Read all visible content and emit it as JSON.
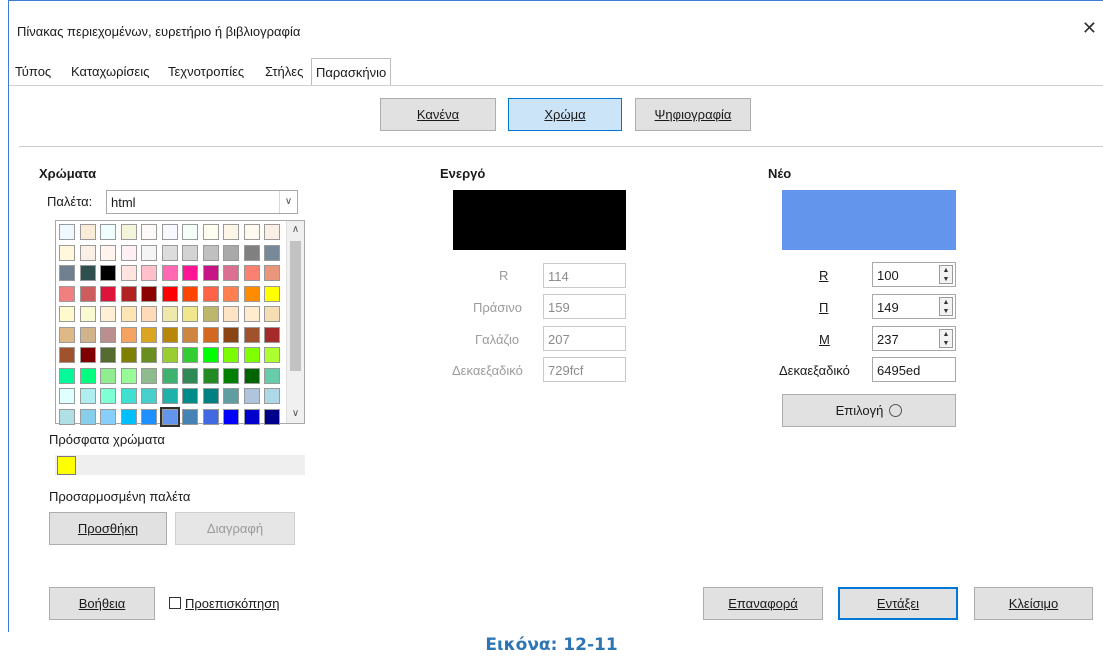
{
  "window": {
    "title": "Πίνακας περιεχομένων, ευρετήριο ή βιβλιογραφία",
    "close_glyph": "✕"
  },
  "tabs": [
    {
      "label": "Τύπος"
    },
    {
      "label": "Καταχωρίσεις"
    },
    {
      "label": "Τεχνοτροπίες"
    },
    {
      "label": "Στήλες"
    },
    {
      "label": "Παρασκήνιο",
      "active": true
    }
  ],
  "background_modes": {
    "none": "Κανένα",
    "color": "Χρώμα",
    "bitmap": "Ψηφιογραφία",
    "selected": "Χρώμα"
  },
  "colors_section": {
    "heading": "Χρώματα",
    "palette_label": "Παλέτα:",
    "palette_value": "html",
    "recent_label": "Πρόσφατα χρώματα",
    "recent_colors": [
      "#ffff00"
    ],
    "custom_palette_label": "Προσαρμοσμένη παλέτα",
    "add_button": "Προσθήκη",
    "delete_button": "Διαγραφή",
    "swatches": [
      [
        "#f0f8ff",
        "#faebd7",
        "#f0ffff",
        "#f5f5dc",
        "#fffafa",
        "#f8f8ff",
        "#f5fffa",
        "#fffff0",
        "#fdf5e6",
        "#fffaf0",
        "#faf0e6"
      ],
      [
        "#fff8dc",
        "#faf0e6",
        "#fff5ee",
        "#fff0f5",
        "#f5f5f5",
        "#dcdcdc",
        "#d3d3d3",
        "#c0c0c0",
        "#a9a9a9",
        "#808080",
        "#778899"
      ],
      [
        "#708090",
        "#2f4f4f",
        "#000000",
        "#ffe4e1",
        "#ffc0cb",
        "#ff69b4",
        "#ff1493",
        "#c71585",
        "#db7093",
        "#fa8072",
        "#e9967a"
      ],
      [
        "#f08080",
        "#cd5c5c",
        "#dc143c",
        "#b22222",
        "#8b0000",
        "#ff0000",
        "#ff4500",
        "#ff6347",
        "#ff7f50",
        "#ff8c00",
        "#ffff00"
      ],
      [
        "#fffacd",
        "#fafad2",
        "#ffefd5",
        "#ffe4b5",
        "#ffdab9",
        "#eee8aa",
        "#f0e68c",
        "#bdb76b",
        "#ffe4c4",
        "#ffebcd",
        "#f5deb3"
      ],
      [
        "#deb887",
        "#d2b48c",
        "#bc8f8f",
        "#f4a460",
        "#daa520",
        "#b8860b",
        "#cd853f",
        "#d2691e",
        "#8b4513",
        "#a0522d",
        "#a52a2a"
      ],
      [
        "#a0522d",
        "#800000",
        "#556b2f",
        "#808000",
        "#6b8e23",
        "#9acd32",
        "#32cd32",
        "#00ff00",
        "#7cfc00",
        "#7fff00",
        "#adff2f"
      ],
      [
        "#00fa9a",
        "#00ff7f",
        "#90ee90",
        "#98fb98",
        "#8fbc8f",
        "#3cb371",
        "#2e8b57",
        "#228b22",
        "#008000",
        "#006400",
        "#66cdaa"
      ],
      [
        "#e0ffff",
        "#afeeee",
        "#7fffd4",
        "#40e0d0",
        "#48d1cc",
        "#20b2aa",
        "#008b8b",
        "#008080",
        "#5f9ea0",
        "#b0c4de",
        "#add8e6"
      ],
      [
        "#b0e0e6",
        "#87ceeb",
        "#87cefa",
        "#00bfff",
        "#1e90ff",
        "#6495ed",
        "#4682b4",
        "#4169e1",
        "#0000ff",
        "#0000cd",
        "#00008b"
      ]
    ],
    "selected_swatch": "#6495ed"
  },
  "active_section": {
    "heading": "Ενεργό",
    "preview_color": "#000000",
    "r_label": "R",
    "r_value": "114",
    "g_label": "Πράσινο",
    "g_value": "159",
    "b_label": "Γαλάζιο",
    "b_value": "207",
    "hex_label": "Δεκαεξαδικό",
    "hex_value": "729fcf"
  },
  "new_section": {
    "heading": "Νέο",
    "preview_color": "#6495ed",
    "r_label": "R",
    "r_value": "100",
    "g_label": "Π",
    "g_value": "149",
    "b_label": "Μ",
    "b_value": "237",
    "hex_label": "Δεκαεξαδικό",
    "hex_value": "6495ed",
    "pick_button": "Επιλογή"
  },
  "footer": {
    "help_button": "Βοήθεια",
    "preview_checkbox_label": "Προεπισκόπηση",
    "preview_checked": false,
    "reset_button": "Επαναφορά",
    "ok_button": "Εντάξει",
    "close_button": "Κλείσιμο"
  },
  "caption": "Εικόνα: 12-11"
}
